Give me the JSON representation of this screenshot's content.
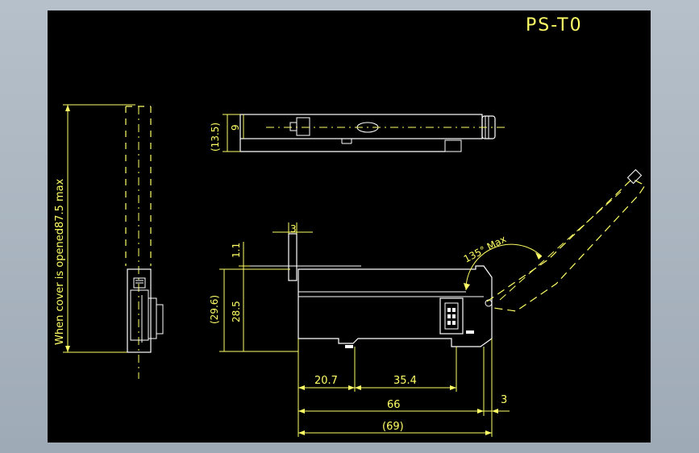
{
  "drawing": {
    "title": "PS-T0",
    "colors": {
      "outline": "#ffffff",
      "dimension": "#ffff66",
      "canvas": "#000000",
      "background": "#a9b4bf"
    },
    "labels": {
      "cover_note": "When cover is opened87.5 max",
      "top_width": "9",
      "top_overall": "(13.5)",
      "tab_width": "3",
      "gap": "1.1",
      "height": "28.5",
      "height_overall": "(29.6)",
      "dim_a": "20.7",
      "dim_b": "35.4",
      "length": "66",
      "right_tab": "3",
      "length_overall": "(69)",
      "angle": "135° Max"
    }
  }
}
